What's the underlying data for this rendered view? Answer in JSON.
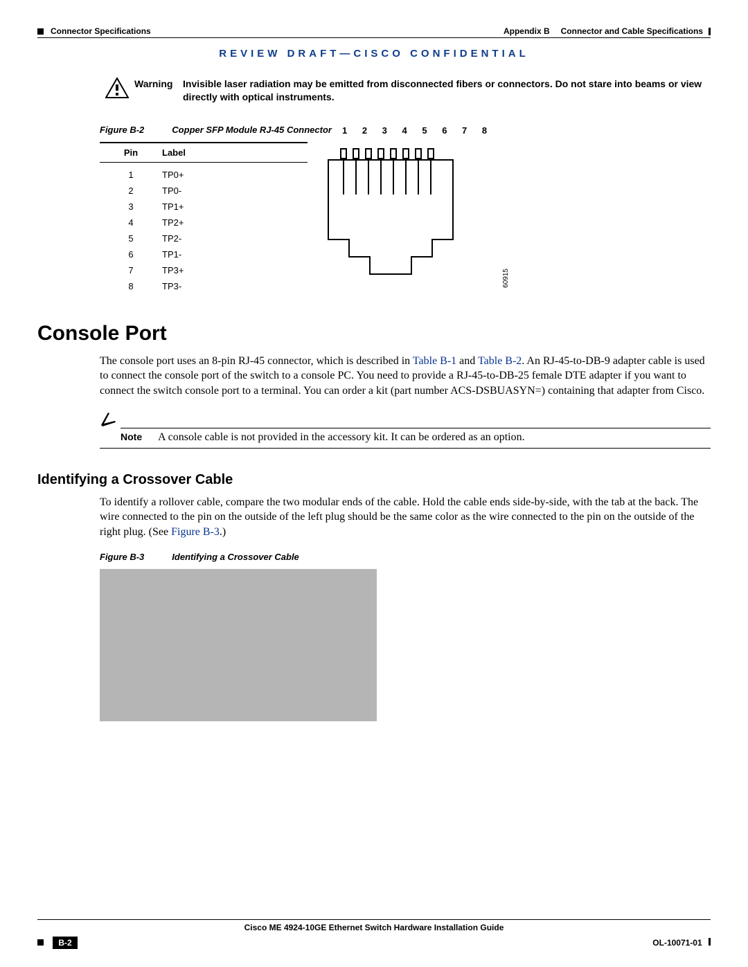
{
  "header": {
    "left_section": "Connector Specifications",
    "right_appendix_label": "Appendix B",
    "right_appendix_title": "Connector and Cable Specifications"
  },
  "confidential_banner": "REVIEW DRAFT—CISCO CONFIDENTIAL",
  "warning": {
    "label": "Warning",
    "text": "Invisible laser radiation may be emitted from disconnected fibers or connectors. Do not stare into beams or view directly with optical instruments."
  },
  "figure_b2": {
    "ref": "Figure B-2",
    "title": "Copper SFP Module RJ-45 Connector",
    "diagram_id": "60915",
    "pin_numbers_header": "1 2 3 4 5 6 7 8",
    "table": {
      "head_pin": "Pin",
      "head_label": "Label",
      "rows": [
        {
          "pin": "1",
          "label": "TP0+"
        },
        {
          "pin": "2",
          "label": "TP0-"
        },
        {
          "pin": "3",
          "label": "TP1+"
        },
        {
          "pin": "4",
          "label": "TP2+"
        },
        {
          "pin": "5",
          "label": "TP2-"
        },
        {
          "pin": "6",
          "label": "TP1-"
        },
        {
          "pin": "7",
          "label": "TP3+"
        },
        {
          "pin": "8",
          "label": "TP3-"
        }
      ]
    }
  },
  "console_port": {
    "heading": "Console Port",
    "para_pre": "The console port uses an 8-pin RJ-45 connector, which is described in ",
    "link1": "Table B-1",
    "mid1": " and ",
    "link2": "Table B-2",
    "para_post": ". An RJ-45-to-DB-9 adapter cable is used to connect the console port of the switch to a console PC. You need to provide a RJ-45-to-DB-25 female DTE adapter if you want to connect the switch console port to a terminal. You can order a kit (part number ACS-DSBUASYN=) containing that adapter from Cisco."
  },
  "note": {
    "label": "Note",
    "text": "A console cable is not provided in the accessory kit. It can be ordered as an option."
  },
  "crossover": {
    "heading": "Identifying a Crossover Cable",
    "para_pre": "To identify a rollover cable, compare the two modular ends of the cable. Hold the cable ends side-by-side, with the tab at the back. The wire connected to the pin on the outside of the left plug should be the same color as the wire connected to the pin on the outside of the right plug. (See ",
    "link": "Figure B-3",
    "para_post": ".)"
  },
  "figure_b3": {
    "ref": "Figure B-3",
    "title": "Identifying a Crossover Cable"
  },
  "footer": {
    "book_title": "Cisco ME 4924-10GE Ethernet Switch Hardware Installation Guide",
    "page_number": "B-2",
    "doc_id": "OL-10071-01"
  }
}
